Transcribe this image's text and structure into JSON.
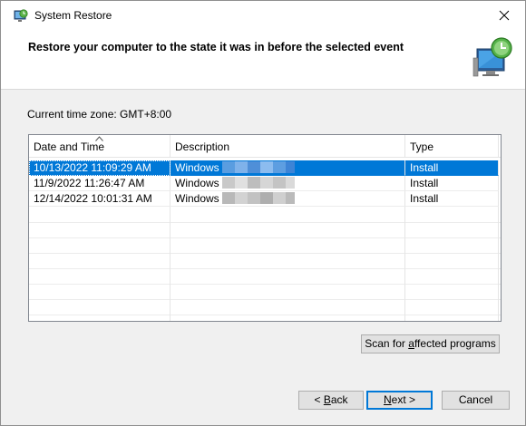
{
  "window": {
    "title": "System Restore",
    "title_icon": "system-restore-icon",
    "close_icon": "close-icon"
  },
  "header": {
    "text": "Restore your computer to the state it was in before the selected event",
    "icon": "system-restore-monitor-icon"
  },
  "timezone": "Current time zone: GMT+8:00",
  "table": {
    "columns": [
      "Date and Time",
      "Description",
      "Type"
    ],
    "sorted_column": "Date and Time",
    "rows": [
      {
        "date": "10/13/2022 11:09:29 AM",
        "description": "Windows",
        "type": "Install",
        "selected": true
      },
      {
        "date": "11/9/2022 11:26:47 AM",
        "description": "Windows",
        "type": "Install",
        "selected": false
      },
      {
        "date": "12/14/2022 10:01:31 AM",
        "description": "Windows",
        "type": "Install",
        "selected": false
      }
    ]
  },
  "buttons": {
    "scan": {
      "before": "Scan for ",
      "accel": "a",
      "after": "ffected programs"
    },
    "back": {
      "before": "< ",
      "accel": "B",
      "after": "ack"
    },
    "next": {
      "before": "",
      "accel": "N",
      "after": "ext >"
    },
    "cancel": "Cancel"
  },
  "colors": {
    "selection": "#0078d7",
    "default_button_border": "#0078d7"
  }
}
